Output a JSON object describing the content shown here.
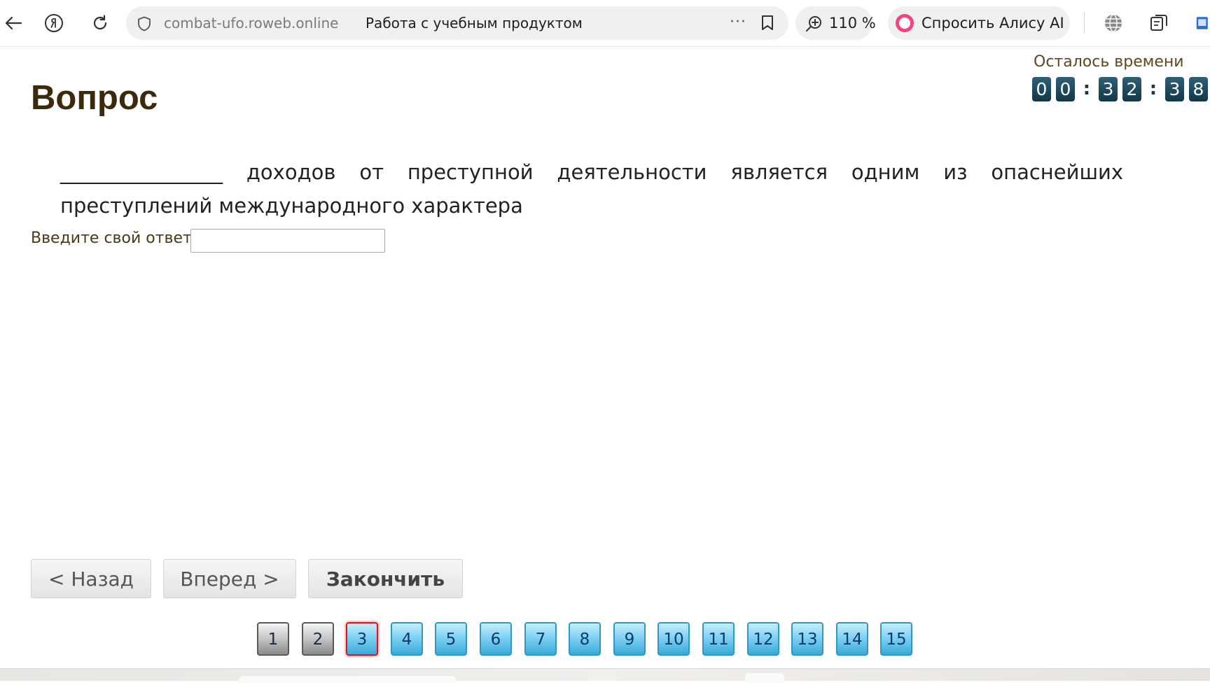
{
  "browser": {
    "domain": "combat-ufo.roweb.online",
    "page_title": "Работа с учебным продуктом",
    "more_label": "···",
    "zoom": "110 %",
    "alice_label": "Спросить Алису AI"
  },
  "page": {
    "heading": "Вопрос",
    "timer_label": "Осталось времени",
    "timer_digits": [
      "0",
      "0",
      "3",
      "2",
      "3",
      "8"
    ],
    "timer_separator": ":",
    "question_text": "________________ доходов от преступной деятельности является одним из опаснейших преступлений международного характера",
    "answer_label": "Введите свой ответ",
    "answer_value": "",
    "buttons": {
      "back": "< Назад",
      "forward": "Вперед >",
      "finish": "Закончить"
    },
    "question_numbers": [
      {
        "label": "1",
        "state": "done"
      },
      {
        "label": "2",
        "state": "done"
      },
      {
        "label": "3",
        "state": "current"
      },
      {
        "label": "4",
        "state": "todo"
      },
      {
        "label": "5",
        "state": "todo"
      },
      {
        "label": "6",
        "state": "todo"
      },
      {
        "label": "7",
        "state": "todo"
      },
      {
        "label": "8",
        "state": "todo"
      },
      {
        "label": "9",
        "state": "todo"
      },
      {
        "label": "10",
        "state": "todo"
      },
      {
        "label": "11",
        "state": "todo"
      },
      {
        "label": "12",
        "state": "todo"
      },
      {
        "label": "13",
        "state": "todo"
      },
      {
        "label": "14",
        "state": "todo"
      },
      {
        "label": "15",
        "state": "todo"
      }
    ]
  },
  "colors": {
    "heading": "#3c2a0c",
    "timer_digit_bg": "#103848",
    "current_question_border": "#e0141e",
    "todo_question_bg": "#7fd2f2",
    "alice_accent": "#f0467a"
  }
}
